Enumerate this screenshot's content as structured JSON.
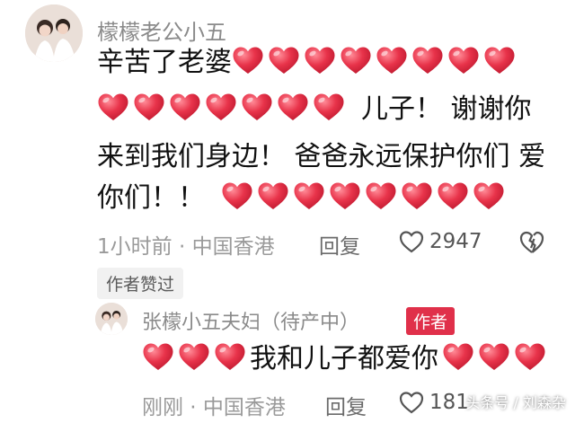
{
  "comment": {
    "username": "檬檬老公小五",
    "line1_text": "辛苦了老婆",
    "line2_text": "儿子！ 谢谢你",
    "line3_text": "来到我们身边！ 爸爸永远保护你们 爱",
    "line4_text": "你们！！",
    "time_location": "1小时前 · 中国香港",
    "reply_label": "回复",
    "like_count": "2947",
    "author_liked_badge": "作者赞过"
  },
  "reply": {
    "username": "张檬小五夫妇（待产中）",
    "author_tag": "作者",
    "text": "我和儿子都爱你",
    "time_location": "刚刚 · 中国香港",
    "reply_label": "回复",
    "like_count": "181"
  },
  "watermark": "头条号 / 刘森杂",
  "colors": {
    "heart": "#e8334a",
    "author_tag": "#e0304a"
  },
  "icons": [
    "heart-icon",
    "like-icon",
    "dislike-icon"
  ]
}
